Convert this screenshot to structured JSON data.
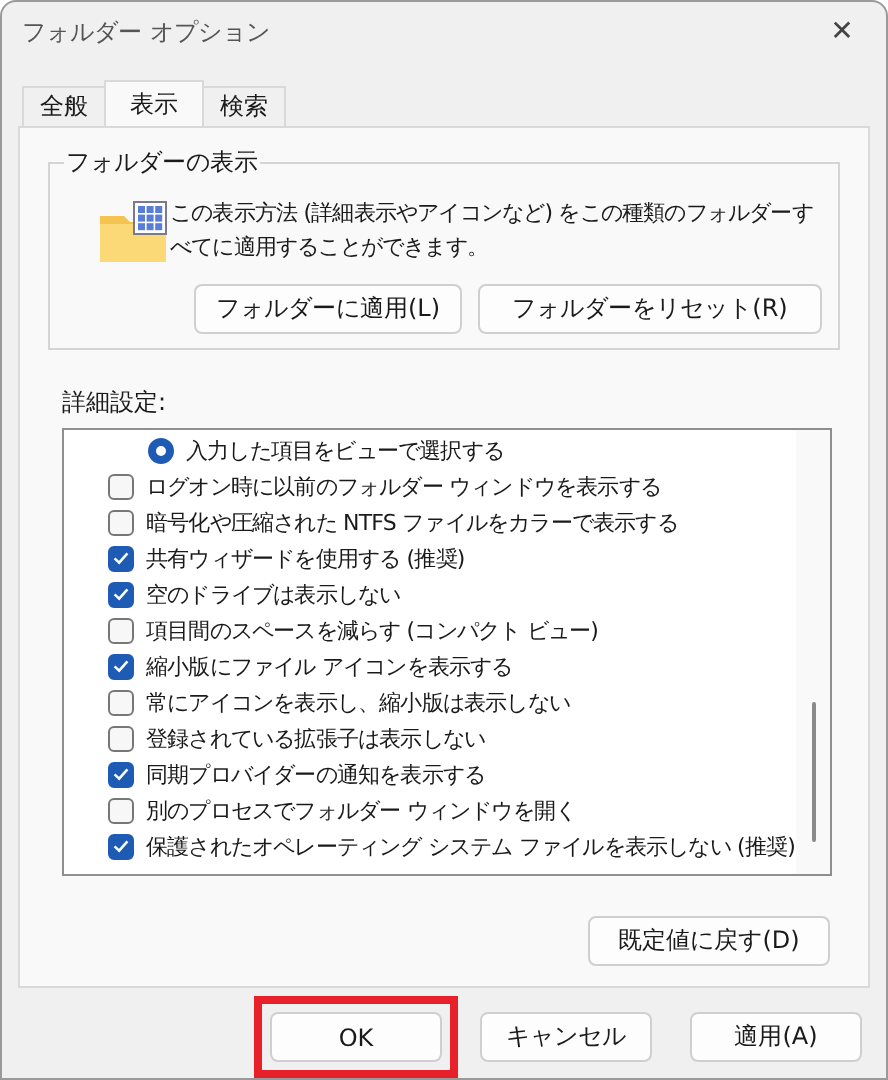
{
  "window": {
    "title": "フォルダー オプション",
    "close": "✕"
  },
  "tabs": [
    {
      "label": "全般",
      "selected": false
    },
    {
      "label": "表示",
      "selected": true
    },
    {
      "label": "検索",
      "selected": false
    }
  ],
  "folder_views": {
    "title": "フォルダーの表示",
    "description": "この表示方法 (詳細表示やアイコンなど) をこの種類のフォルダーすべてに適用することができます。",
    "buttons": [
      "フォルダーに適用(L)",
      "フォルダーをリセット(R)"
    ]
  },
  "advanced": {
    "label": "詳細設定:",
    "items": [
      {
        "kind": "radio",
        "label": "入力した項目をビューで選択する",
        "checked": true
      },
      {
        "kind": "checkbox",
        "label": "ログオン時に以前のフォルダー ウィンドウを表示する",
        "checked": false
      },
      {
        "kind": "checkbox",
        "label": "暗号化や圧縮された NTFS ファイルをカラーで表示する",
        "checked": false
      },
      {
        "kind": "checkbox",
        "label": "共有ウィザードを使用する (推奨)",
        "checked": true
      },
      {
        "kind": "checkbox",
        "label": "空のドライブは表示しない",
        "checked": true
      },
      {
        "kind": "checkbox",
        "label": "項目間のスペースを減らす (コンパクト ビュー)",
        "checked": false
      },
      {
        "kind": "checkbox",
        "label": "縮小版にファイル アイコンを表示する",
        "checked": true
      },
      {
        "kind": "checkbox",
        "label": "常にアイコンを表示し、縮小版は表示しない",
        "checked": false
      },
      {
        "kind": "checkbox",
        "label": "登録されている拡張子は表示しない",
        "checked": false
      },
      {
        "kind": "checkbox",
        "label": "同期プロバイダーの通知を表示する",
        "checked": true
      },
      {
        "kind": "checkbox",
        "label": "別のプロセスでフォルダー ウィンドウを開く",
        "checked": false
      },
      {
        "kind": "checkbox",
        "label": "保護されたオペレーティング システム ファイルを表示しない (推奨)",
        "checked": true
      }
    ],
    "restore_button": "既定値に戻す(D)"
  },
  "buttons": [
    {
      "label": "OK",
      "highlighted": true
    },
    {
      "label": "キャンセル",
      "highlighted": false
    },
    {
      "label": "適用(A)",
      "highlighted": false
    }
  ]
}
